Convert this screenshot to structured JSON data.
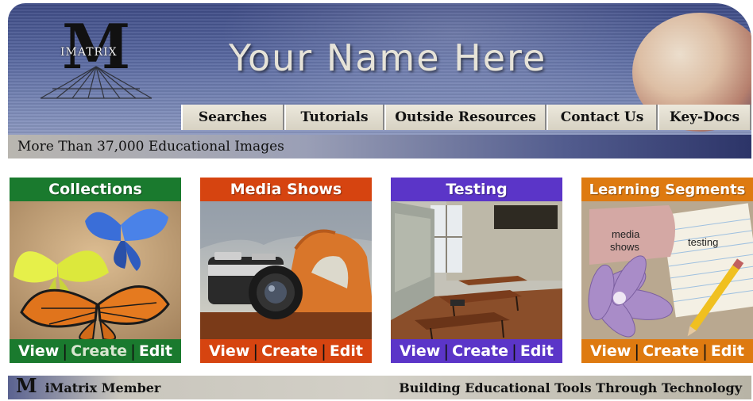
{
  "header": {
    "logo_letter": "M",
    "logo_text": "IMATRIX",
    "site_title": "Your Name Here",
    "tagline": "More Than 37,000 Educational Images"
  },
  "nav": {
    "tabs": [
      {
        "label": "Searches"
      },
      {
        "label": "Tutorials"
      },
      {
        "label": "Outside Resources"
      },
      {
        "label": "Contact Us"
      },
      {
        "label": "Key-Docs"
      }
    ]
  },
  "cards": [
    {
      "title": "Collections",
      "color": "#1a7a2e",
      "image": "butterflies",
      "view": "View",
      "create": "Create",
      "edit": "Edit"
    },
    {
      "title": "Media Shows",
      "color": "#d64410",
      "image": "camera-canyon",
      "view": "View",
      "create": "Create",
      "edit": "Edit"
    },
    {
      "title": "Testing",
      "color": "#5b35c8",
      "image": "classroom",
      "view": "View",
      "create": "Create",
      "edit": "Edit"
    },
    {
      "title": "Learning Segments",
      "color": "#de7a10",
      "image": "flower-collage",
      "view": "View",
      "create": "Create",
      "edit": "Edit",
      "image_labels": {
        "media": "media",
        "shows": "shows",
        "testing": "testing"
      }
    }
  ],
  "footer": {
    "logo_letter": "M",
    "member": "iMatrix Member",
    "slogan": "Building Educational Tools Through Technology"
  }
}
